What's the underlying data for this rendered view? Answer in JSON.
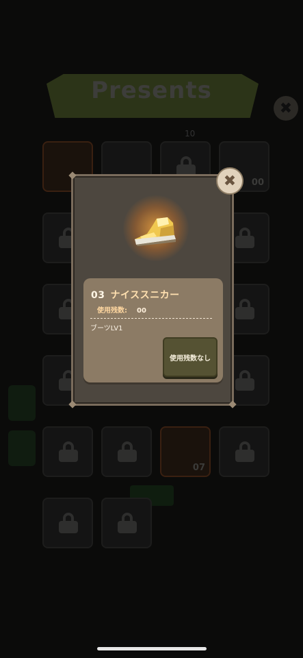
{
  "screen": {
    "title": "Presents",
    "count_text": "10"
  },
  "grid": {
    "tiles": [
      {
        "state": "orange",
        "number": ""
      },
      {
        "state": "item",
        "number": ""
      },
      {
        "state": "locked",
        "number": ""
      },
      {
        "state": "item",
        "number": "00"
      },
      {
        "state": "locked",
        "number": ""
      },
      {
        "state": "locked",
        "number": ""
      },
      {
        "state": "locked",
        "number": ""
      },
      {
        "state": "locked",
        "number": ""
      },
      {
        "state": "locked",
        "number": ""
      },
      {
        "state": "locked",
        "number": ""
      },
      {
        "state": "locked",
        "number": ""
      },
      {
        "state": "locked",
        "number": ""
      },
      {
        "state": "locked",
        "number": ""
      },
      {
        "state": "locked",
        "number": ""
      },
      {
        "state": "locked",
        "number": ""
      },
      {
        "state": "locked",
        "number": ""
      },
      {
        "state": "locked",
        "number": ""
      },
      {
        "state": "locked",
        "number": ""
      },
      {
        "state": "item",
        "number": "07"
      },
      {
        "state": "locked",
        "number": ""
      },
      {
        "state": "locked",
        "number": ""
      },
      {
        "state": "locked",
        "number": ""
      }
    ]
  },
  "dialog": {
    "item_number": "03",
    "item_name": "ナイススニカー",
    "usage_label": "使用残数:",
    "usage_value": "00",
    "description": "ブーツLV1",
    "use_button_label": "使用残数なし",
    "item_icon": "sneaker-icon",
    "close_icon": "close-icon"
  },
  "colors": {
    "accent_orange": "#ffd7a0",
    "dialog_bg": "#4d473f",
    "card_bg": "#8c7b65",
    "button_bg": "#555233"
  }
}
